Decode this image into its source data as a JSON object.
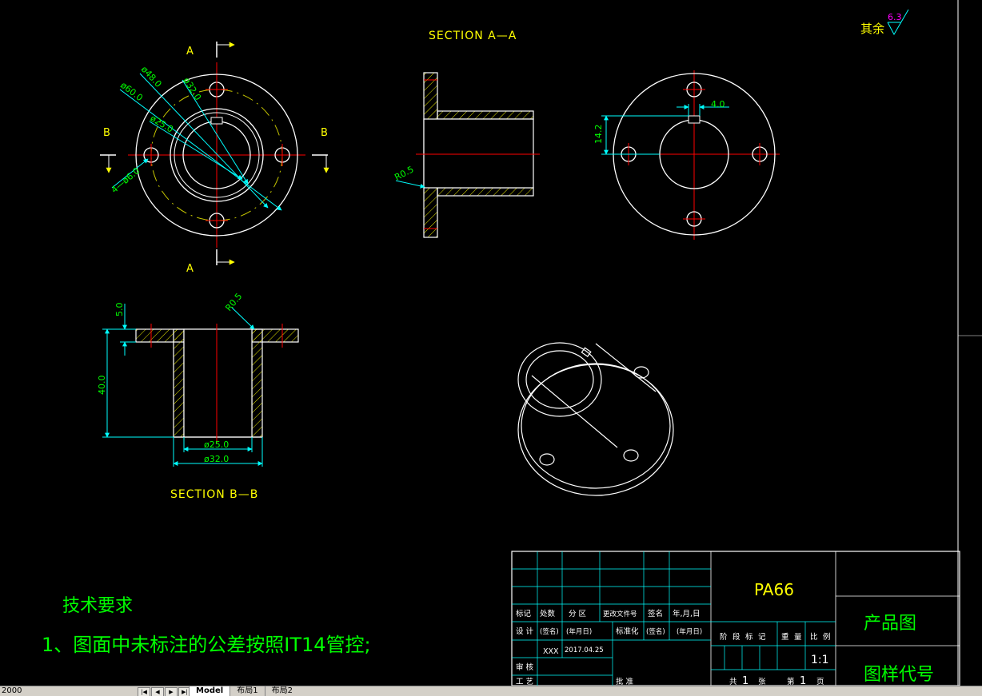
{
  "drawing": {
    "roughness": {
      "label": "其余",
      "value": "6.3"
    },
    "section_a_title": "SECTION A—A",
    "section_b_title": "SECTION B—B",
    "markers": {
      "a_top": "A",
      "a_bottom": "A",
      "b_left": "B",
      "b_right": "B"
    },
    "front_dims": {
      "d48": "ø48.0",
      "d60": "ø60.0",
      "d32": "ø32.0",
      "d25": "ø25.0",
      "holes": "4—ø6.0"
    },
    "section_a_dims": {
      "radius": "R0.5"
    },
    "right_dims": {
      "key_width": "4.0",
      "key_height": "14.2"
    },
    "section_b_dims": {
      "flange": "5.0",
      "height": "40.0",
      "radius": "R0.5",
      "inner": "ø25.0",
      "outer": "ø32.0"
    }
  },
  "notes": {
    "title": "技术要求",
    "line1": "1、图面中未标注的公差按照IT14管控;"
  },
  "title_block": {
    "material": "PA66",
    "product": "产品图",
    "drawing_no": "图样代号",
    "scale": "1:1",
    "row1": [
      "标记",
      "处数",
      "分 区",
      "更改文件号",
      "签名",
      "年,月,日"
    ],
    "row2": [
      "设 计",
      "(签名)",
      "(年月日)",
      "标准化",
      "(签名)",
      "(年月日)"
    ],
    "stage": [
      "阶",
      "段",
      "标",
      "记",
      "重",
      "量",
      "比",
      "例"
    ],
    "designer": "XXX",
    "date": "2017.04.25",
    "review": "审 核",
    "process": "工 艺",
    "approve": "批 准",
    "sheets": [
      "共",
      "1",
      "张",
      "第",
      "1",
      "页"
    ]
  },
  "statusbar": {
    "coords": "2000",
    "tabs": [
      "Model",
      "布局1",
      "布局2"
    ]
  },
  "colors": {
    "outline": "#ffffff",
    "dimension": "#00ffff",
    "dim_text": "#00ff00",
    "centerline": "#ff0000",
    "hatch": "#ffff00",
    "label": "#ffff00",
    "roughness_value": "#ff00ff",
    "phantom": "#c8c800"
  }
}
